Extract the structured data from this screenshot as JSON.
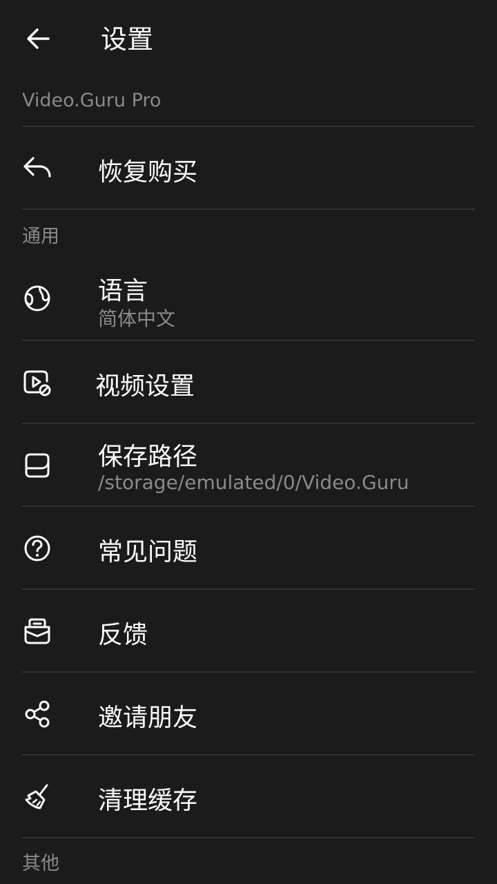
{
  "header": {
    "title": "设置"
  },
  "sections": {
    "pro": "Video.Guru Pro",
    "general": "通用",
    "other": "其他"
  },
  "items": {
    "restore": {
      "label": "恢复购买",
      "icon": "reply-icon"
    },
    "language": {
      "label": "语言",
      "value": "简体中文",
      "icon": "globe-icon"
    },
    "video": {
      "label": "视频设置",
      "icon": "video-settings-icon"
    },
    "save_path": {
      "label": "保存路径",
      "value": "/storage/emulated/0/Video.Guru",
      "icon": "save-icon"
    },
    "faq": {
      "label": "常见问题",
      "icon": "help-icon"
    },
    "feedback": {
      "label": "反馈",
      "icon": "mail-icon"
    },
    "invite": {
      "label": "邀请朋友",
      "icon": "share-icon"
    },
    "clear_cache": {
      "label": "清理缓存",
      "icon": "broom-icon"
    }
  }
}
